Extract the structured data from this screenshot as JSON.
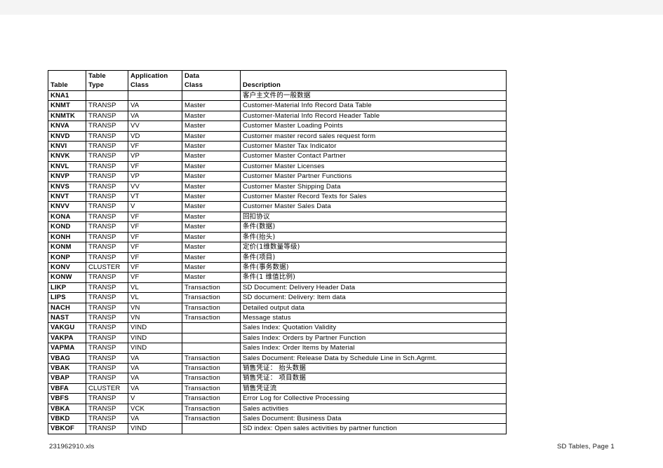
{
  "document": {
    "page_background": "#ffffff",
    "top_strip_color": "#f4f4f4",
    "border_color": "#000000"
  },
  "table": {
    "name": "SD Tables",
    "headers": [
      {
        "line1": "",
        "line2": "Table"
      },
      {
        "line1": "Table",
        "line2": "Type"
      },
      {
        "line1": "Application",
        "line2": "Class"
      },
      {
        "line1": "Data",
        "line2": "Class"
      },
      {
        "line1": "",
        "line2": "Description"
      }
    ],
    "rows": [
      {
        "table": "KNA1",
        "type": "",
        "app": "",
        "data": "",
        "desc": "客户主文件的一般数据",
        "desc_cjk": true
      },
      {
        "table": "KNMT",
        "type": "TRANSP",
        "app": "VA",
        "data": "Master",
        "desc": "Customer-Material Info Record Data Table",
        "desc_cjk": false
      },
      {
        "table": "KNMTK",
        "type": "TRANSP",
        "app": "VA",
        "data": "Master",
        "desc": "Customer-Material Info Record Header Table",
        "desc_cjk": false
      },
      {
        "table": "KNVA",
        "type": "TRANSP",
        "app": "VV",
        "data": "Master",
        "desc": "Customer Master Loading Points",
        "desc_cjk": false
      },
      {
        "table": "KNVD",
        "type": "TRANSP",
        "app": "VD",
        "data": "Master",
        "desc": "Customer master record sales request form",
        "desc_cjk": false
      },
      {
        "table": "KNVI",
        "type": "TRANSP",
        "app": "VF",
        "data": "Master",
        "desc": "Customer Master Tax Indicator",
        "desc_cjk": false
      },
      {
        "table": "KNVK",
        "type": "TRANSP",
        "app": "VP",
        "data": "Master",
        "desc": "Customer Master Contact Partner",
        "desc_cjk": false
      },
      {
        "table": "KNVL",
        "type": "TRANSP",
        "app": "VF",
        "data": "Master",
        "desc": "Customer Master Licenses",
        "desc_cjk": false
      },
      {
        "table": "KNVP",
        "type": "TRANSP",
        "app": "VP",
        "data": "Master",
        "desc": "Customer Master Partner Functions",
        "desc_cjk": false
      },
      {
        "table": "KNVS",
        "type": "TRANSP",
        "app": "VV",
        "data": "Master",
        "desc": "Customer Master Shipping Data",
        "desc_cjk": false
      },
      {
        "table": "KNVT",
        "type": "TRANSP",
        "app": "VT",
        "data": "Master",
        "desc": "Customer Master Record Texts for Sales",
        "desc_cjk": false
      },
      {
        "table": "KNVV",
        "type": "TRANSP",
        "app": "V",
        "data": "Master",
        "desc": "Customer Master Sales Data",
        "desc_cjk": false
      },
      {
        "table": "KONA",
        "type": "TRANSP",
        "app": "VF",
        "data": "Master",
        "desc": "回扣协议",
        "desc_cjk": true
      },
      {
        "table": "KOND",
        "type": "TRANSP",
        "app": "VF",
        "data": "Master",
        "desc": "条件(数据)",
        "desc_cjk": true
      },
      {
        "table": "KONH",
        "type": "TRANSP",
        "app": "VF",
        "data": "Master",
        "desc": "条件(抬头)",
        "desc_cjk": true
      },
      {
        "table": "KONM",
        "type": "TRANSP",
        "app": "VF",
        "data": "Master",
        "desc": "定价(1维数量等级)",
        "desc_cjk": true
      },
      {
        "table": "KONP",
        "type": "TRANSP",
        "app": "VF",
        "data": "Master",
        "desc": "条件(项目)",
        "desc_cjk": true
      },
      {
        "table": "KONV",
        "type": "CLUSTER",
        "app": "VF",
        "data": "Master",
        "desc": "条件(事务数据)",
        "desc_cjk": true
      },
      {
        "table": "KONW",
        "type": "TRANSP",
        "app": "VF",
        "data": "Master",
        "desc": "条件(1 维值比例)",
        "desc_cjk": true
      },
      {
        "table": "LIKP",
        "type": "TRANSP",
        "app": "VL",
        "data": "Transaction",
        "desc": "SD Document: Delivery Header Data",
        "desc_cjk": false
      },
      {
        "table": "LIPS",
        "type": "TRANSP",
        "app": "VL",
        "data": "Transaction",
        "desc": "SD document: Delivery: Item data",
        "desc_cjk": false
      },
      {
        "table": "NACH",
        "type": "TRANSP",
        "app": "VN",
        "data": "Transaction",
        "desc": "Detailed output data",
        "desc_cjk": false
      },
      {
        "table": "NAST",
        "type": "TRANSP",
        "app": "VN",
        "data": "Transaction",
        "desc": "Message status",
        "desc_cjk": false
      },
      {
        "table": "VAKGU",
        "type": "TRANSP",
        "app": "VIND",
        "data": "",
        "desc": "Sales Index: Quotation Validity",
        "desc_cjk": false
      },
      {
        "table": "VAKPA",
        "type": "TRANSP",
        "app": "VIND",
        "data": "",
        "desc": "Sales Index: Orders by Partner Function",
        "desc_cjk": false
      },
      {
        "table": "VAPMA",
        "type": "TRANSP",
        "app": "VIND",
        "data": "",
        "desc": "Sales Index: Order Items by Material",
        "desc_cjk": false
      },
      {
        "table": "VBAG",
        "type": "TRANSP",
        "app": "VA",
        "data": "Transaction",
        "desc": "Sales Document: Release Data by Schedule Line in Sch.Agrmt.",
        "desc_cjk": false
      },
      {
        "table": "VBAK",
        "type": "TRANSP",
        "app": "VA",
        "data": "Transaction",
        "desc": "销售凭证： 抬头数据",
        "desc_cjk": true
      },
      {
        "table": "VBAP",
        "type": "TRANSP",
        "app": "VA",
        "data": "Transaction",
        "desc": "销售凭证： 项目数据",
        "desc_cjk": true
      },
      {
        "table": "VBFA",
        "type": "CLUSTER",
        "app": "VA",
        "data": "Transaction",
        "desc": "销售凭证流",
        "desc_cjk": true
      },
      {
        "table": "VBFS",
        "type": "TRANSP",
        "app": "V",
        "data": "Transaction",
        "desc": "Error Log for Collective Processing",
        "desc_cjk": false
      },
      {
        "table": "VBKA",
        "type": "TRANSP",
        "app": "VCK",
        "data": "Transaction",
        "desc": "Sales activities",
        "desc_cjk": false
      },
      {
        "table": "VBKD",
        "type": "TRANSP",
        "app": "VA",
        "data": "Transaction",
        "desc": "Sales Document: Business Data",
        "desc_cjk": false
      },
      {
        "table": "VBKOF",
        "type": "TRANSP",
        "app": "VIND",
        "data": "",
        "desc": "SD index: Open sales activities by partner function",
        "desc_cjk": false
      }
    ]
  },
  "footer": {
    "file_name": "231962910.xls",
    "page_label": "SD Tables, Page 1"
  }
}
